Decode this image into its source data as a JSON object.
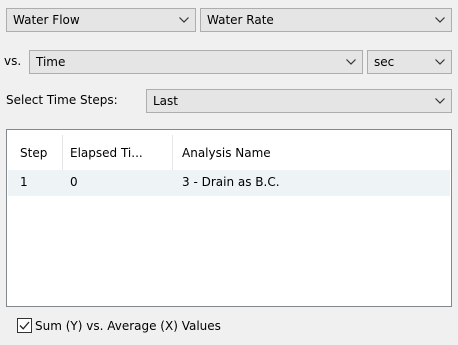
{
  "selectors": {
    "y_quantity": "Water Flow",
    "y_rate": "Water Rate",
    "vs_label": "vs.",
    "x_quantity": "Time",
    "x_unit": "sec",
    "time_steps_label": "Select Time Steps:",
    "time_steps_value": "Last"
  },
  "table": {
    "columns": [
      "Step",
      "Elapsed Ti...",
      "Analysis Name"
    ],
    "rows": [
      [
        "1",
        "0",
        "3 - Drain as B.C."
      ]
    ]
  },
  "options": {
    "sum_avg_label": "Sum (Y) vs. Average (X) Values",
    "sum_avg_checked": true
  },
  "icons": {
    "dropdown": "chevron-down-icon",
    "check": "checkmark-icon"
  }
}
